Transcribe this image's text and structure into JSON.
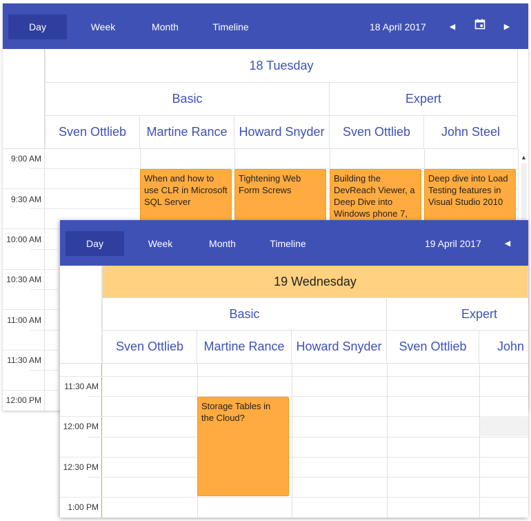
{
  "back": {
    "views": [
      "Day",
      "Week",
      "Month",
      "Timeline"
    ],
    "active_view": "Day",
    "date_label": "18 April 2017",
    "day_header": "18 Tuesday",
    "groups": [
      "Basic",
      "Expert"
    ],
    "resources": [
      "Sven Ottlieb",
      "Martine Rance",
      "Howard Snyder",
      "Sven Ottlieb",
      "John Steel"
    ],
    "times": [
      "9:00 AM",
      "9:30 AM",
      "10:00 AM",
      "10:30 AM",
      "11:00 AM",
      "11:30 AM",
      "12:00 PM"
    ],
    "appointments": [
      "When and how to use CLR in Microsoft SQL Server",
      "Tightening Web Form Screws",
      "Building the DevReach Viewer, a Deep Dive into Windows phone 7,",
      "Deep dive into Load Testing features in Visual Studio 2010"
    ]
  },
  "front": {
    "views": [
      "Day",
      "Week",
      "Month",
      "Timeline"
    ],
    "active_view": "Day",
    "date_label": "19 April 2017",
    "day_header": "19 Wednesday",
    "groups": [
      "Basic",
      "Expert"
    ],
    "resources": [
      "Sven Ottlieb",
      "Martine Rance",
      "Howard Snyder",
      "Sven Ottlieb",
      "John"
    ],
    "times": [
      "11:30 AM",
      "12:00 PM",
      "12:30 PM",
      "1:00 PM"
    ],
    "appointments": [
      "Storage Tables in the Cloud?"
    ]
  },
  "colors": {
    "toolbar": "#3f51b5",
    "active_view": "#303f9f",
    "header_text": "#3f51b5",
    "today_header": "#ffd180",
    "appointment": "#ffab40"
  }
}
